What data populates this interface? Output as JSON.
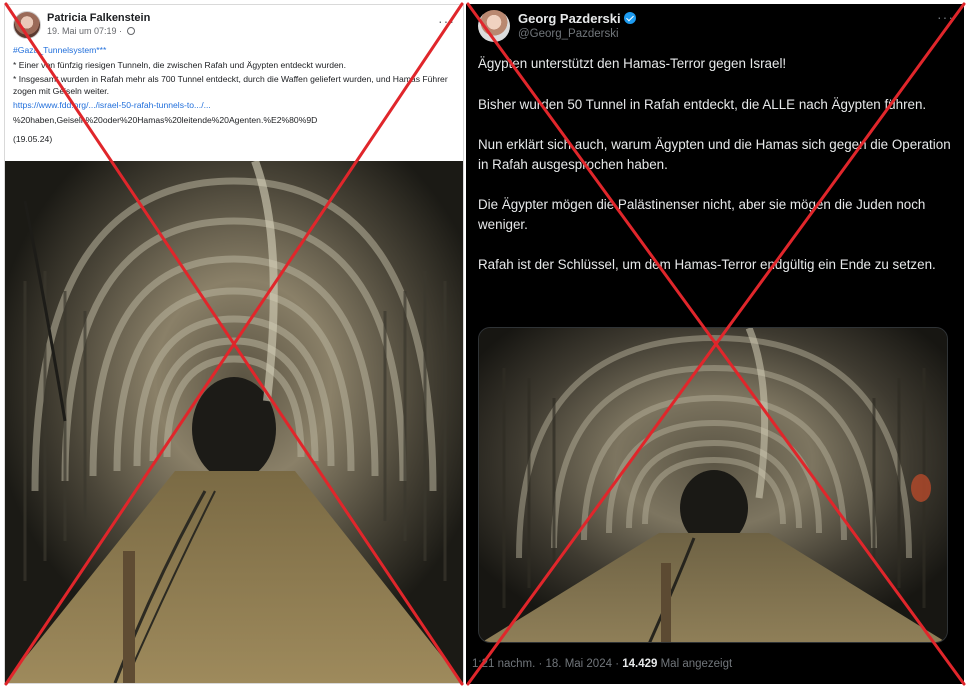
{
  "facebook_post": {
    "author": "Patricia Falkenstein",
    "timestamp": "19. Mai um 07:19 ·",
    "more_icon": "more-horizontal-icon",
    "hashtag": "#Gaza_Tunnelsystem***",
    "lines": [
      "* Einer von fünfzig riesigen Tunneln, die zwischen Rafah und Ägypten entdeckt wurden.",
      "* Insgesamt wurden in Rafah mehr als 700 Tunnel entdeckt, durch die Waffen geliefert wurden, und Hamas Führer zogen mit Geiseln weiter."
    ],
    "link_line_1": "https://www.fdd.org/.../israel-50-rafah-tunnels-to.../...",
    "link_line_2": "%20haben,Geiseln%20oder%20Hamas%20leitende%20Agenten.%E2%80%9D",
    "date_note": "(19.05.24)"
  },
  "x_post": {
    "author": "Georg Pazderski",
    "handle": "@Georg_Pazderski",
    "verified_icon": "verified-badge-icon",
    "more_icon": "more-horizontal-icon",
    "paragraphs": [
      "Ägypten unterstützt den Hamas-Terror gegen Israel!",
      "Bisher wurden 50 Tunnel in Rafah entdeckt, die ALLE nach Ägypten führen.",
      "Nun erklärt sich auch, warum Ägypten und die Hamas sich gegen die Operation in Rafah ausgesprochen haben.",
      "Die Ägypter mögen die Palästinenser nicht, aber sie mögen die Juden noch weniger.",
      "Rafah ist der Schlüssel, um dem Hamas-Terror endgültig ein Ende zu setzen."
    ],
    "footer_time": "1:21 nachm. · 18. Mai 2024 · ",
    "footer_views": "14.429",
    "footer_views_label": " Mal angezeigt"
  },
  "colors": {
    "strike_red": "#e0262b",
    "x_background": "#000000",
    "link_blue": "#216fdb",
    "verified_blue": "#1d9bf0"
  }
}
